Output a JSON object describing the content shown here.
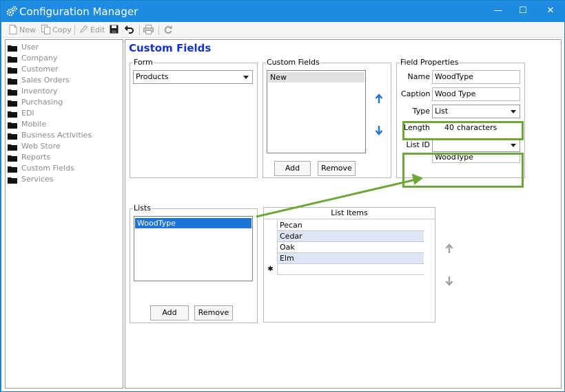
{
  "window": {
    "title": "Configuration Manager",
    "minimize_glyph": "—",
    "maximize_glyph": "☐",
    "close_glyph": "✕"
  },
  "toolbar": {
    "new_label": "New",
    "copy_label": "Copy",
    "edit_label": "Edit"
  },
  "sidebar": {
    "items": [
      {
        "label": "User"
      },
      {
        "label": "Company"
      },
      {
        "label": "Customer"
      },
      {
        "label": "Sales Orders"
      },
      {
        "label": "Inventory"
      },
      {
        "label": "Purchasing"
      },
      {
        "label": "EDI"
      },
      {
        "label": "Mobile"
      },
      {
        "label": "Business Activities"
      },
      {
        "label": "Web Store"
      },
      {
        "label": "Reports"
      },
      {
        "label": "Custom Fields"
      },
      {
        "label": "Services"
      }
    ]
  },
  "main": {
    "page_title": "Custom Fields",
    "form_group": {
      "label": "Form",
      "selected": "Products"
    },
    "custom_fields_group": {
      "label": "Custom Fields",
      "items": [
        "New"
      ],
      "add_label": "Add",
      "remove_label": "Remove"
    },
    "field_properties": {
      "label": "Field Properties",
      "name_label": "Name",
      "name_value": "WoodType",
      "caption_label": "Caption",
      "caption_value": "Wood Type",
      "type_label": "Type",
      "type_value": "List",
      "length_label": "Length",
      "length_value": "40",
      "length_unit": "characters",
      "list_id_label": "List ID",
      "list_id_value": "",
      "list_id_option": "WoodType"
    },
    "lists_group": {
      "label": "Lists",
      "items": [
        "WoodType"
      ],
      "add_label": "Add",
      "remove_label": "Remove"
    },
    "list_items_grid": {
      "header": "List Items",
      "rows": [
        "Pecan",
        "Cedar",
        "Oak",
        "Elm"
      ],
      "new_row_marker": "✱"
    }
  },
  "colors": {
    "title_bar": "#1c8be0",
    "page_title": "#1633c6",
    "selection": "#1e73d6",
    "highlight_box": "#6fa736",
    "callout_arrow": "#6fa736",
    "alt_row": "#dce6f7"
  }
}
